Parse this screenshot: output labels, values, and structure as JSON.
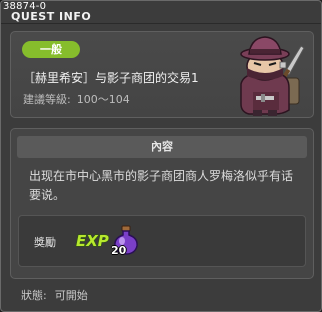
{
  "window": {
    "id": "38874-0",
    "title": "QUEST INFO"
  },
  "quest": {
    "category": "一般",
    "name": "［赫里希安］与影子商团的交易1",
    "level_label": "建議等級:",
    "level_value": "100～104"
  },
  "content": {
    "header": "內容",
    "description": "出现在市中心黑市的影子商团商人罗梅洛似乎有话要说。"
  },
  "reward": {
    "label": "獎勵",
    "items": [
      {
        "icon": "exp-icon",
        "text": "EXP"
      },
      {
        "icon": "purple-potion-icon",
        "count": "20"
      }
    ]
  },
  "status": {
    "label": "狀態:",
    "value": "可開始"
  },
  "colors": {
    "window_bg": "#3c3c3c",
    "panel_bg": "#454545",
    "badge_green": "#86bd2c",
    "exp_green": "#b7e82e",
    "potion_purple": "#7a3fc8"
  }
}
